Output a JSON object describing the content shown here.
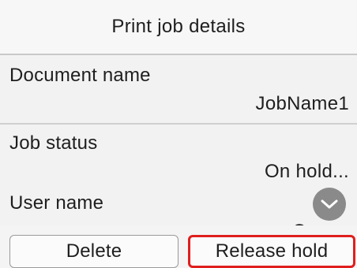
{
  "header": {
    "title": "Print job details"
  },
  "details": {
    "document": {
      "label": "Document name",
      "value": "JobName1"
    },
    "status": {
      "label": "Job status",
      "value": "On hold..."
    },
    "user": {
      "label": "User name",
      "value": "Owner"
    }
  },
  "scroll": {
    "icon": "chevron-down-icon"
  },
  "actions": {
    "delete_label": "Delete",
    "release_label": "Release hold",
    "highlight_color": "#e01e1e"
  }
}
